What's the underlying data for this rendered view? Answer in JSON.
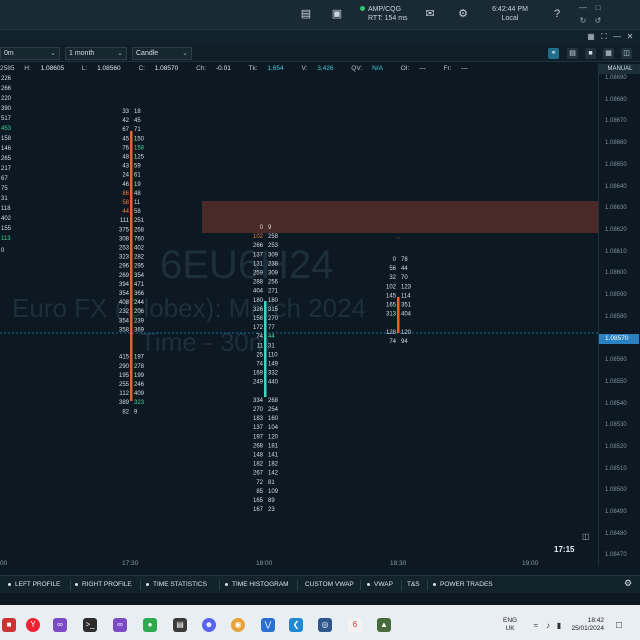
{
  "topbar": {
    "connection_name": "AMP/CQG",
    "connection_rtt": "RTT: 154 ms",
    "time": "6:42:44 PM",
    "time_zone": "Local"
  },
  "controls": {
    "interval_value": "0m",
    "period_value": "1 month",
    "chart_type_value": "Candle"
  },
  "info": {
    "h_label": "H:",
    "h_value": "1.08605",
    "l_label": "L:",
    "l_value": "1.08560",
    "c_label": "C:",
    "c_value": "1.08570",
    "ch_label": "Ch:",
    "ch_value": "-0.01",
    "tk_label": "Tk:",
    "tk_value": "1,654",
    "v_label": "V:",
    "v_value": "3,426",
    "qv_label": "QV:",
    "qv_value": "N/A",
    "oi_label": "OI:",
    "oi_value": "---",
    "fr_label": "Fr:",
    "fr_value": "---",
    "left_partial": "2585"
  },
  "watermark": {
    "symbol": "6EU6H24",
    "description": "Euro FX (Globex): March 2024",
    "timeframe": "Time - 30m"
  },
  "price_axis": {
    "mode": "MANUAL",
    "current_price": "1.08570",
    "ticks": [
      "1.08690",
      "1.08680",
      "1.08670",
      "1.08660",
      "1.08650",
      "1.08640",
      "1.08630",
      "1.08620",
      "1.08610",
      "1.08600",
      "1.08590",
      "1.08580",
      "1.08560",
      "1.08550",
      "1.08540",
      "1.08530",
      "1.08520",
      "1.08510",
      "1.08500",
      "1.08490",
      "1.08480",
      "1.08470"
    ]
  },
  "time_axis": {
    "ticks": [
      "00",
      "17:30",
      "18:00",
      "18:30",
      "19:00"
    ],
    "current_time": "17:15"
  },
  "footprint": {
    "left_column": [
      "226",
      "266",
      "220",
      "390",
      "517",
      "453",
      "158",
      "146",
      "265",
      "217",
      "67",
      "75",
      "31",
      "118",
      "402",
      "155",
      "113",
      "0"
    ],
    "col1_bid": [
      "33",
      "42",
      "67",
      "45",
      "76",
      "48",
      "43",
      "24",
      "46",
      "86",
      "58",
      "44",
      "111",
      "375",
      "308",
      "253",
      "323",
      "296",
      "269",
      "394",
      "354",
      "408",
      "232",
      "354",
      "358",
      "",
      "",
      "415",
      "290",
      "195",
      "255",
      "112",
      "389",
      "82"
    ],
    "col1_ask": [
      "18",
      "45",
      "71",
      "150",
      "158",
      "125",
      "59",
      "61",
      "19",
      "48",
      "11",
      "58",
      "251",
      "258",
      "760",
      "402",
      "282",
      "295",
      "354",
      "471",
      "366",
      "244",
      "206",
      "239",
      "369",
      "",
      "",
      "197",
      "278",
      "199",
      "246",
      "409",
      "323",
      "9"
    ],
    "col2_bid": [
      "0",
      "102",
      "266",
      "137",
      "131",
      "259",
      "288",
      "404",
      "180",
      "326",
      "156",
      "172",
      "74",
      "11",
      "25",
      "74",
      "169",
      "249",
      "",
      "334",
      "270",
      "183",
      "137",
      "197",
      "268",
      "148",
      "182",
      "267",
      "72",
      "85",
      "165",
      "167"
    ],
    "col2_ask": [
      "9",
      "258",
      "253",
      "309",
      "238",
      "309",
      "256",
      "271",
      "180",
      "315",
      "270",
      "77",
      "44",
      "31",
      "110",
      "149",
      "332",
      "440",
      "",
      "268",
      "254",
      "160",
      "104",
      "120",
      "181",
      "141",
      "182",
      "142",
      "81",
      "109",
      "89",
      "23"
    ],
    "col3_bid": [
      "0",
      "56",
      "32",
      "102",
      "145",
      "165",
      "313",
      "",
      "128",
      "74"
    ],
    "col3_ask": [
      "78",
      "44",
      "70",
      "123",
      "114",
      "351",
      "404",
      "",
      "120",
      "94"
    ]
  },
  "tabs": [
    "LEFT PROFILE",
    "RIGHT PROFILE",
    "TIME STATISTICS",
    "TIME HISTOGRAM",
    "CUSTOM VWAP",
    "VWAP",
    "T&S",
    "POWER TRADES"
  ],
  "taskbar": {
    "lang_top": "ENG",
    "lang_bottom": "UK",
    "clock_time": "18:42",
    "clock_date": "25/01/2024"
  },
  "colors": {
    "background": "#0c1922",
    "accent_blue": "#2a82c2",
    "bar_orange": "#e8632b",
    "bar_teal": "#3fd3c2",
    "highlight_green": "#46d39a",
    "highlight_orange": "#f07a3a",
    "zone_brown": "#4a2a26"
  }
}
